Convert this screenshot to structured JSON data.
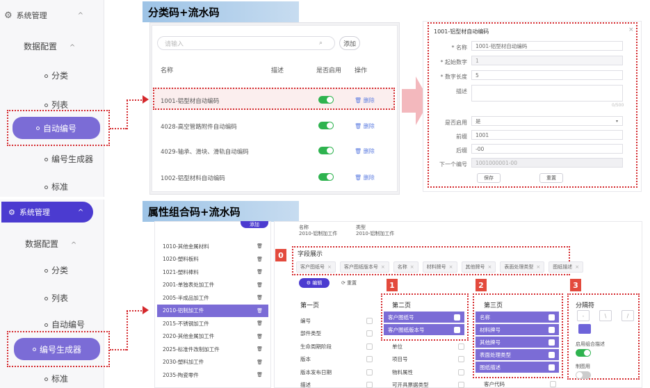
{
  "top": {
    "banner": "分类码+流水码",
    "nav": {
      "header": "系统管理",
      "sub": "数据配置",
      "items": [
        "分类",
        "列表",
        "自动编号",
        "编号生成器",
        "标准"
      ],
      "active_index": 2
    },
    "list": {
      "search_placeholder": "请输入",
      "add_label": "添加",
      "columns": [
        "名称",
        "描述",
        "是否启用",
        "操作"
      ],
      "rows": [
        {
          "name": "1001-铝型材自动编码",
          "enabled": true,
          "action": "删除"
        },
        {
          "name": "4028-高空管路附件自动编码",
          "enabled": true,
          "action": "删除"
        },
        {
          "name": "4029-轴承、滑块、滑轨自动编码",
          "enabled": true,
          "action": "删除"
        },
        {
          "name": "1002-铝型材料自动编码",
          "enabled": true,
          "action": "删除"
        }
      ]
    },
    "form": {
      "title": "1001-铝型材自动编码",
      "close": "×",
      "fields": [
        {
          "label": "* 名称",
          "value": "1001-铝型材自动编码"
        },
        {
          "label": "* 起始数字",
          "value": "1"
        },
        {
          "label": "* 数字长度",
          "value": "5"
        },
        {
          "label": "描述",
          "value": ""
        }
      ],
      "counter": "0/500",
      "enabled_label": "是否启用",
      "enabled_value": "是",
      "prefix_label": "前缀",
      "prefix_value": "1001",
      "suffix_label": "后缀",
      "suffix_value": "-00",
      "next_label": "下一个编号",
      "next_value": "1001000001-00",
      "btn_save": "保存",
      "btn_reset": "重置"
    }
  },
  "bottom": {
    "banner": "属性组合码+流水码",
    "nav": {
      "header": "系统管理",
      "sub": "数据配置",
      "items": [
        "分类",
        "列表",
        "自动编号",
        "编号生成器",
        "标准"
      ],
      "active_index": 3
    },
    "left_list": {
      "add_label": "添加",
      "rows": [
        "1010-其他金属材料",
        "1020-塑料板料",
        "1021-塑料棒料",
        "2001-单独表处加工件",
        "2005-半成品加工件",
        "2010-铝制加工件",
        "2015-不锈钢加工件",
        "2020-其他金属加工件",
        "2025-标准件改制加工件",
        "2030-塑料加工件",
        "2035-陶瓷零件"
      ],
      "active_index": 5
    },
    "header_info": {
      "name_label": "名称",
      "name_value": "2010-铝制加工件",
      "type_label": "类型",
      "type_value": "2010-铝制加工件"
    },
    "section_title": "字段展示",
    "chips": [
      "客户图纸号",
      "客户图纸版本号",
      "名称",
      "材料牌号",
      "其他牌号",
      "表面处理类型",
      "图纸描述"
    ],
    "btn_edit": "编辑",
    "btn_reset": "重置",
    "badges": [
      "0",
      "1",
      "2",
      "3"
    ],
    "page1": {
      "title": "第一页",
      "rows": [
        "编号",
        "部件类型",
        "生命周期阶段",
        "版本",
        "版本发布日期",
        "描述"
      ]
    },
    "page2": {
      "title": "第二页",
      "selected": [
        "客户图纸号",
        "客户图纸版本号"
      ],
      "rows": [
        "单位",
        "项目号",
        "物料属性",
        "可开具票据类型"
      ]
    },
    "page3": {
      "title": "第三页",
      "selected": [
        "名称",
        "材料牌号",
        "其他牌号",
        "表面处理类型",
        "图纸描述"
      ],
      "rows": [
        "客户代码"
      ]
    },
    "separator": {
      "title": "分隔符",
      "options": [
        "-",
        "\\",
        "/"
      ],
      "enable_label": "启用组合描述",
      "drawing_label": "制图用"
    }
  }
}
